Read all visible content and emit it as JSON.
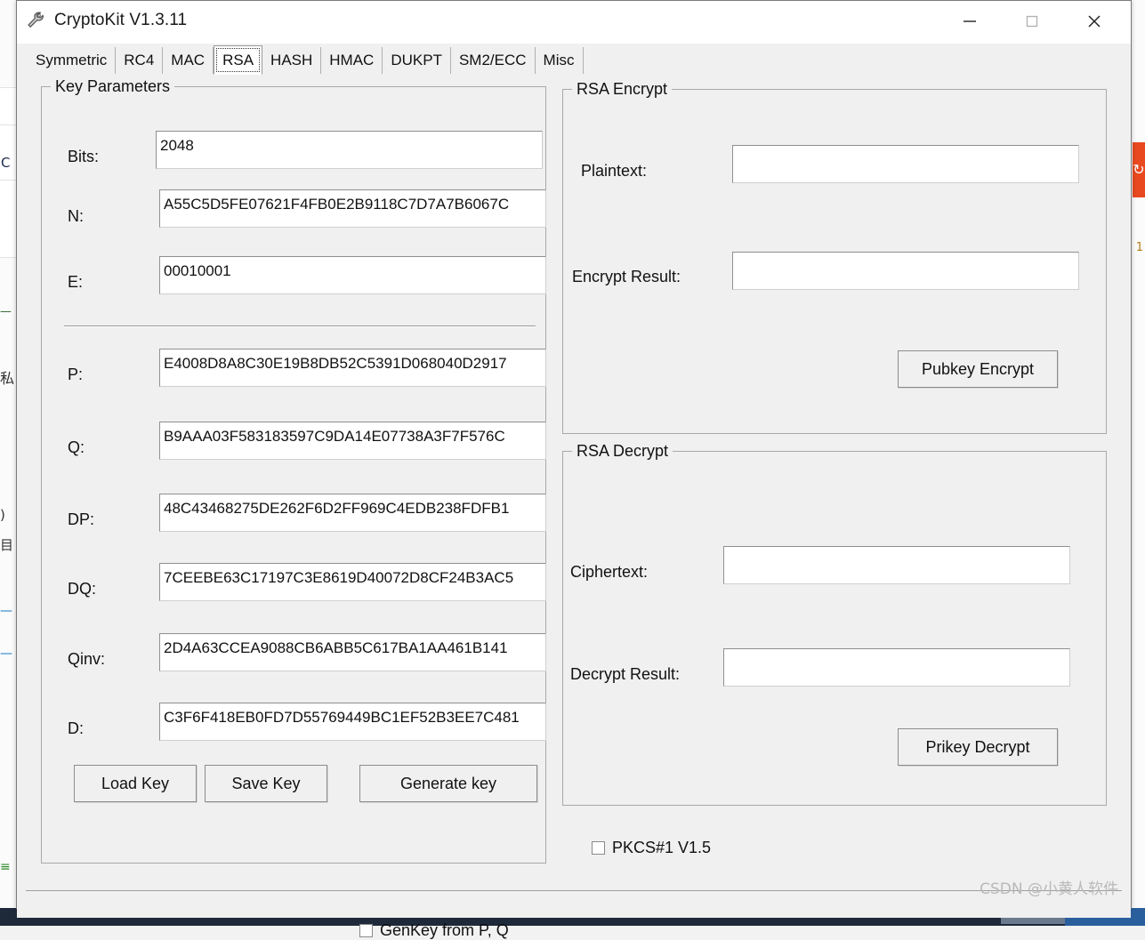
{
  "window": {
    "title": "CryptoKit V1.3.11",
    "icon": "wrench-key-icon",
    "controls": {
      "minimize": "minimize-icon",
      "maximize": "maximize-icon",
      "close": "close-icon"
    }
  },
  "tabs": [
    {
      "label": "Symmetric",
      "selected": false
    },
    {
      "label": "RC4",
      "selected": false
    },
    {
      "label": "MAC",
      "selected": false
    },
    {
      "label": "RSA",
      "selected": true
    },
    {
      "label": "HASH",
      "selected": false
    },
    {
      "label": "HMAC",
      "selected": false
    },
    {
      "label": "DUKPT",
      "selected": false
    },
    {
      "label": "SM2/ECC",
      "selected": false
    },
    {
      "label": "Misc",
      "selected": false
    }
  ],
  "key_parameters": {
    "title": "Key Parameters",
    "fields": [
      {
        "label": "Bits:",
        "value": "2048"
      },
      {
        "label": "N:",
        "value": "A55C5D5FE07621F4FB0E2B9118C7D7A7B6067C"
      },
      {
        "label": "E:",
        "value": "00010001"
      },
      {
        "label": "P:",
        "value": "E4008D8A8C30E19B8DB52C5391D068040D2917"
      },
      {
        "label": "Q:",
        "value": "B9AAA03F583183597C9DA14E07738A3F7F576C"
      },
      {
        "label": "DP:",
        "value": "48C43468275DE262F6D2FF969C4EDB238FDFB1"
      },
      {
        "label": "DQ:",
        "value": "7CEEBE63C17197C3E8619D40072D8CF24B3AC5"
      },
      {
        "label": "Qinv:",
        "value": "2D4A63CCEA9088CB6ABB5C617BA1AA461B141"
      },
      {
        "label": "D:",
        "value": "C3F6F418EB0FD7D55769449BC1EF52B3EE7C481"
      }
    ],
    "buttons": {
      "load_key": "Load Key",
      "save_key": "Save Key",
      "generate_key": "Generate key"
    },
    "checkbox": {
      "label": "GenKey from P, Q",
      "checked": false
    }
  },
  "rsa_encrypt": {
    "title": "RSA Encrypt",
    "plaintext_label": "Plaintext:",
    "plaintext_value": "",
    "result_label": "Encrypt Result:",
    "result_value": "",
    "button": "Pubkey Encrypt"
  },
  "rsa_decrypt": {
    "title": "RSA Decrypt",
    "ciphertext_label": "Ciphertext:",
    "ciphertext_value": "",
    "result_label": "Decrypt Result:",
    "result_value": "",
    "button": "Prikey Decrypt"
  },
  "pkcs_checkbox": {
    "label": "PKCS#1 V1.5",
    "checked": false
  },
  "watermark": "CSDN @小黄人软件",
  "colors": {
    "window_bg": "#f0f0f0",
    "titlebar_bg": "#ffffff",
    "field_bg": "#ffffff",
    "border": "#a9a9a9",
    "text": "#111111",
    "accent_red": "#e8491f"
  }
}
